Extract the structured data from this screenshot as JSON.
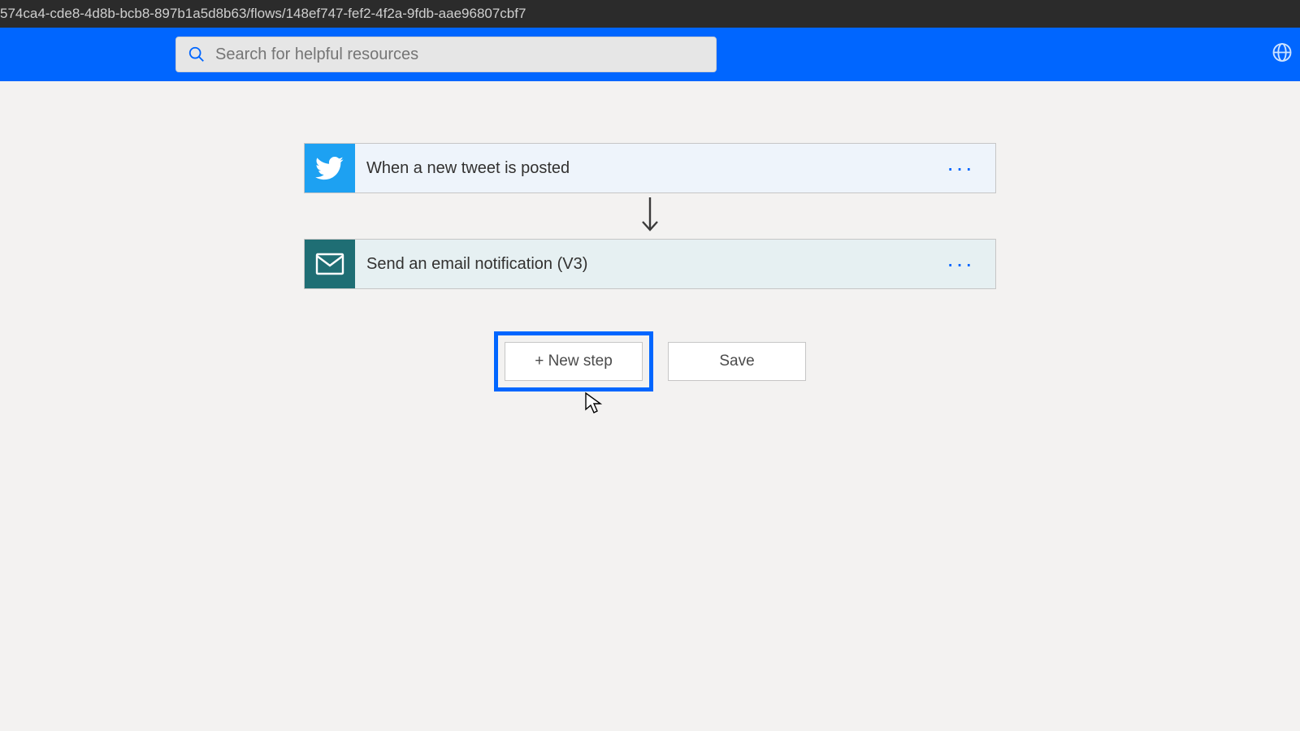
{
  "addressBar": "574ca4-cde8-4d8b-bcb8-897b1a5d8b63/flows/148ef747-fef2-4f2a-9fdb-aae96807cbf7",
  "search": {
    "placeholder": "Search for helpful resources"
  },
  "flow": {
    "trigger": {
      "title": "When a new tweet is posted"
    },
    "action": {
      "title": "Send an email notification (V3)"
    }
  },
  "buttons": {
    "newStep": "+ New step",
    "save": "Save"
  }
}
